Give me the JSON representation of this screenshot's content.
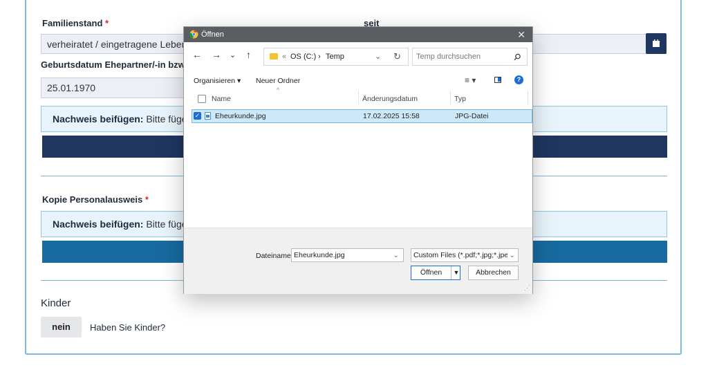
{
  "form": {
    "familienstand_label": "Familienstand",
    "required_mark": "*",
    "seit_label": "seit",
    "familienstand_value": "verheiratet / eingetragene Lebens",
    "geburtsdatum_label": "Geburtsdatum Ehepartner/-in bzw. L",
    "geburtsdatum_value": "25.01.1970",
    "nachweis_bold": "Nachweis beifügen:",
    "nachweis_text": "Bitte fügen",
    "kopie_label": "Kopie Personalausweis",
    "kinder_title": "Kinder",
    "kinder_toggle": "nein",
    "kinder_question": "Haben Sie Kinder?"
  },
  "colors": {
    "dark_bar": "#1f3660",
    "blue_bar": "#176aa0",
    "border_accent": "#7cb7dc"
  },
  "dialog": {
    "title": "Öffnen",
    "close_glyph": "✕",
    "breadcrumb_sep": "«",
    "breadcrumb_drive": "OS (C:)",
    "breadcrumb_arrow": "›",
    "breadcrumb_folder": "Temp",
    "search_placeholder": "Temp durchsuchen",
    "organize_label": "Organisieren",
    "new_folder_label": "Neuer Ordner",
    "columns": {
      "name": "Name",
      "date": "Änderungsdatum",
      "type": "Typ"
    },
    "files": [
      {
        "name": "Eheurkunde.jpg",
        "date": "17.02.2025 15:58",
        "type": "JPG-Datei"
      }
    ],
    "filename_label": "Dateiname:",
    "filename_value": "Eheurkunde.jpg",
    "filter_value": "Custom Files (*.pdf;*.jpg;*.jpeg;",
    "open_button": "Öffnen",
    "cancel_button": "Abbrechen"
  }
}
